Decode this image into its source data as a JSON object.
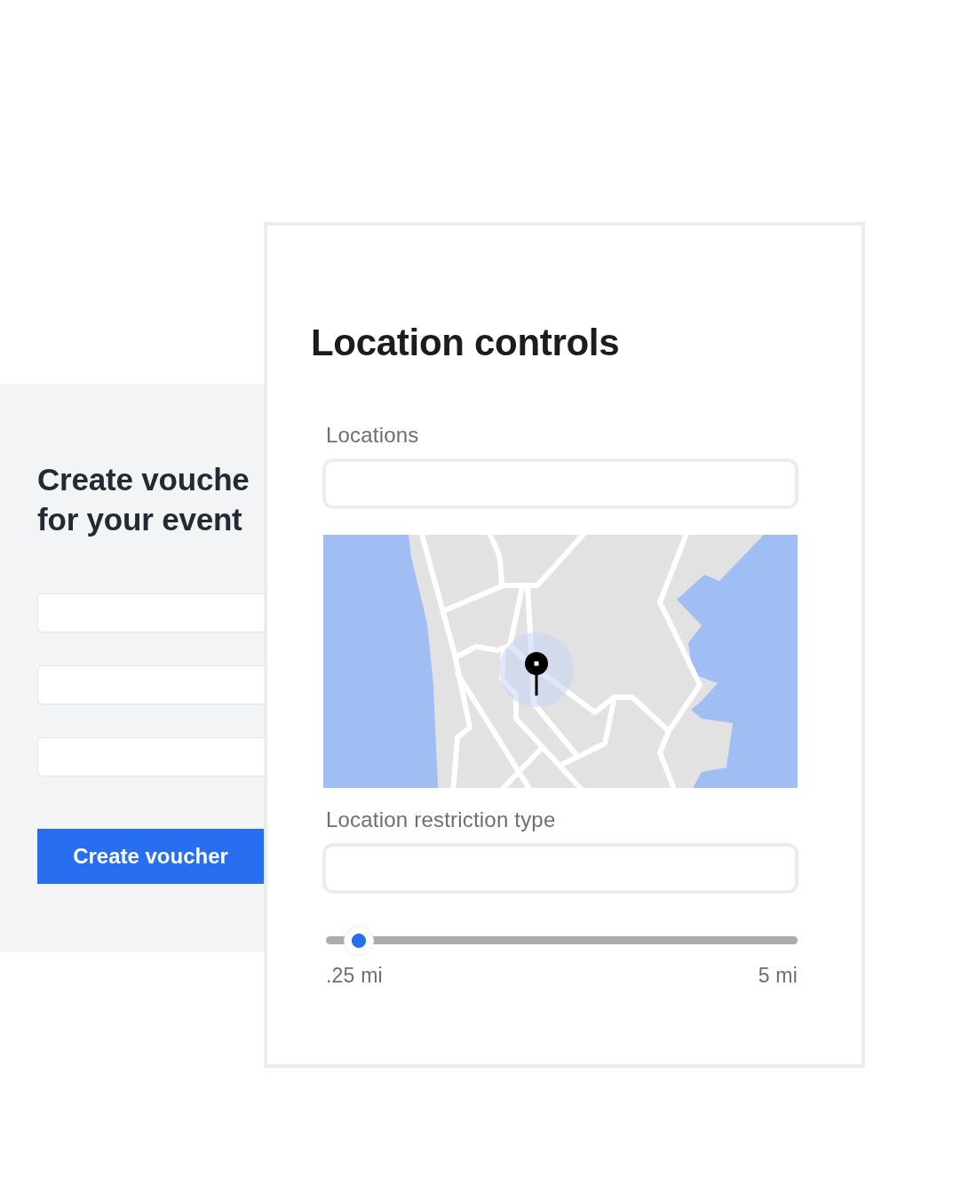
{
  "voucher_panel": {
    "title": "Create vouche\nfor your event",
    "fields": [
      {
        "kind": "text"
      },
      {
        "kind": "text"
      },
      {
        "kind": "text"
      }
    ],
    "button": {
      "label": "Create voucher"
    }
  },
  "location_card": {
    "title": "Location controls",
    "controls": [
      {
        "kind": "field",
        "label": "Locations"
      },
      {
        "kind": "map"
      },
      {
        "kind": "field",
        "label": "Location restriction type"
      },
      {
        "kind": "slider",
        "level": 0.07,
        "min_label": ".25 mi",
        "max_label": "5 mi"
      }
    ]
  }
}
